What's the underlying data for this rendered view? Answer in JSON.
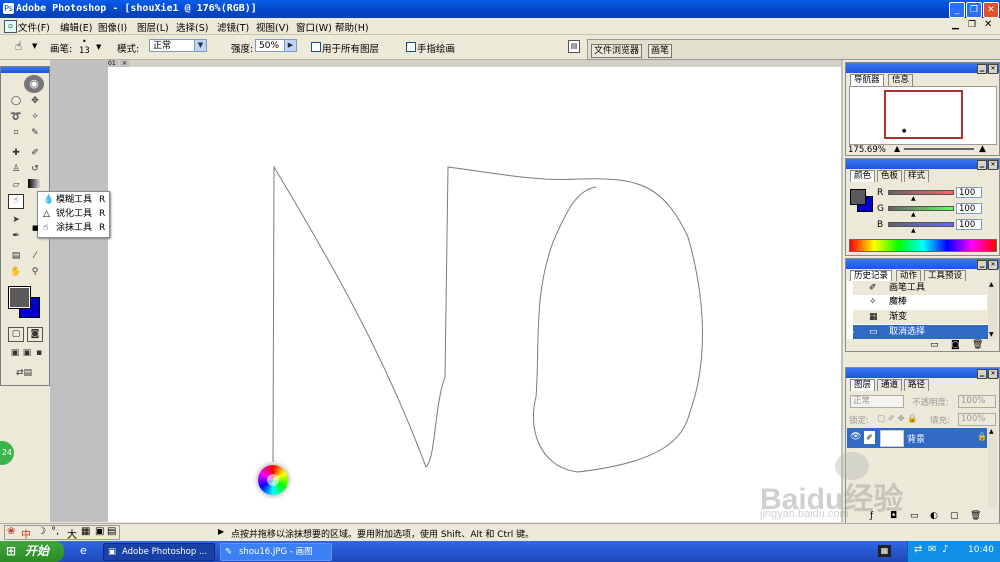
{
  "window": {
    "title": "Adobe Photoshop - [shouXie1 @ 176%(RGB)]"
  },
  "menu": [
    "文件(F)",
    "编辑(E)",
    "图像(I)",
    "图层(L)",
    "选择(S)",
    "滤镜(T)",
    "视图(V)",
    "窗口(W)",
    "帮助(H)"
  ],
  "options": {
    "brush_label": "画笔:",
    "brush_size": "13",
    "mode_label": "模式:",
    "mode_value": "正常",
    "strength_label": "强度:",
    "strength_value": "50%",
    "all_layers_label": "用于所有图层",
    "finger_paint_label": "手指绘画",
    "tab_file_browser": "文件浏览器",
    "tab_brushes": "画笔"
  },
  "flyout": [
    {
      "label": "模糊工具",
      "key": "R"
    },
    {
      "label": "锐化工具",
      "key": "R"
    },
    {
      "label": "涂抹工具",
      "key": "R"
    }
  ],
  "navigator": {
    "tab1": "导航器",
    "tab2": "信息",
    "zoom": "175.69%"
  },
  "color_panel": {
    "tab1": "颜色",
    "tab2": "色板",
    "tab3": "样式",
    "r_label": "R",
    "g_label": "G",
    "b_label": "B",
    "r": "100",
    "g": "100",
    "b": "100"
  },
  "history": {
    "tab1": "历史记录",
    "tab2": "动作",
    "tab3": "工具预设",
    "items": [
      "画笔工具",
      "魔棒",
      "渐变",
      "取消选择"
    ]
  },
  "layers": {
    "tab1": "图层",
    "tab2": "通道",
    "tab3": "路径",
    "blend": "正常",
    "opacity_label": "不透明度:",
    "opacity": "100%",
    "lock_label": "锁定:",
    "fill_label": "填充:",
    "fill": "100%",
    "layer_name": "背景"
  },
  "status": {
    "ime": "中",
    "ime_size": "大",
    "message": "点按并拖移以涂抹想要的区域。要用附加选项，使用 Shift、Alt 和 Ctrl 键。"
  },
  "taskbar": {
    "start": "开始",
    "item1": "Adobe Photoshop ...",
    "item2": "shou16.JPG - 画图",
    "clock": "10:40"
  },
  "watermark": {
    "brand": "Baidu经验",
    "url": "jingyan.baidu.com"
  },
  "side_badge": "24",
  "canvas_tab": "01",
  "colors": {
    "title_blue": "#0347c9",
    "foreground": "#5a5a5a",
    "background": "#0000cc",
    "selection": "#316ac5"
  }
}
